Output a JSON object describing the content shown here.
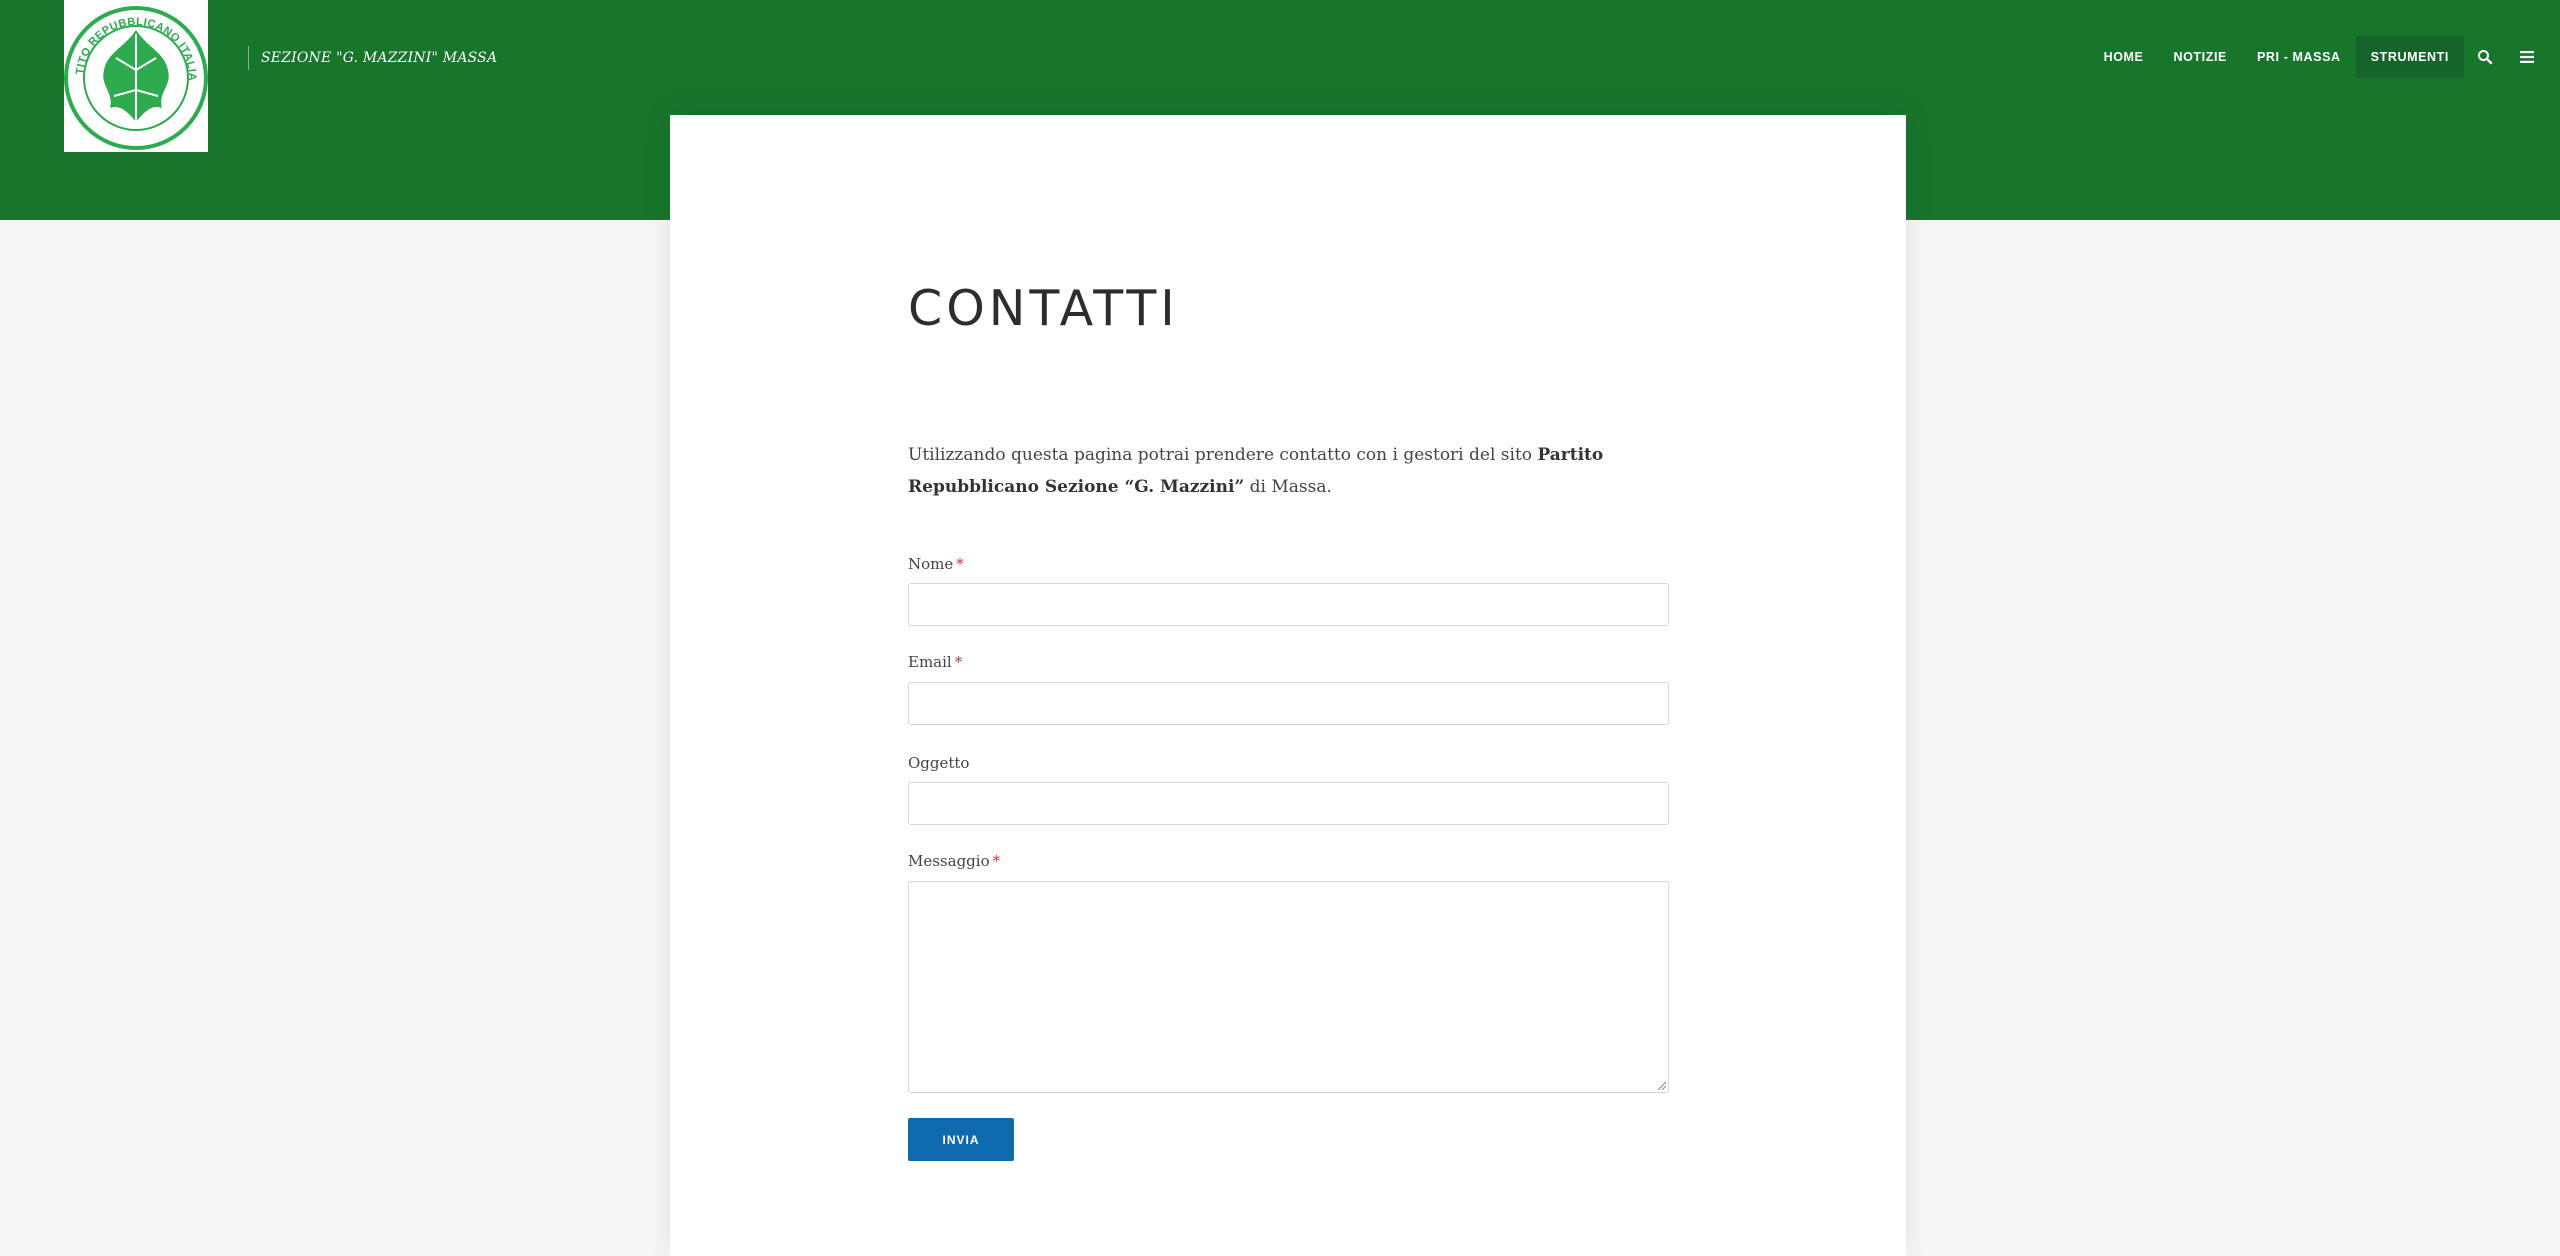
{
  "site": {
    "tagline": "SEZIONE \"G. MAZZINI\" MASSA",
    "logo_text": "PARTITO REPUBBLICANO ITALIANO",
    "brand_color": "#18762c"
  },
  "nav": {
    "items": [
      {
        "label": "HOME",
        "active": false
      },
      {
        "label": "NOTIZIE",
        "active": false
      },
      {
        "label": "PRI - MASSA",
        "active": false
      },
      {
        "label": "STRUMENTI",
        "active": true
      }
    ],
    "search_icon": "search-icon",
    "menu_icon": "hamburger-menu-icon"
  },
  "page": {
    "title": "CONTATTI",
    "intro_start": "Utilizzando questa pagina potrai prendere contatto con i gestori del sito ",
    "intro_bold": "Partito Repubblicano Sezione “G. Mazzini”",
    "intro_end": " di Massa."
  },
  "form": {
    "fields": [
      {
        "label": "Nome",
        "required": true,
        "value": ""
      },
      {
        "label": "Email",
        "required": true,
        "value": ""
      },
      {
        "label": "Oggetto",
        "required": false,
        "value": ""
      },
      {
        "label": "Messaggio",
        "required": true,
        "value": ""
      }
    ],
    "required_mark": "*",
    "submit_label": "INVIA",
    "submit_color": "#0e6aad"
  }
}
